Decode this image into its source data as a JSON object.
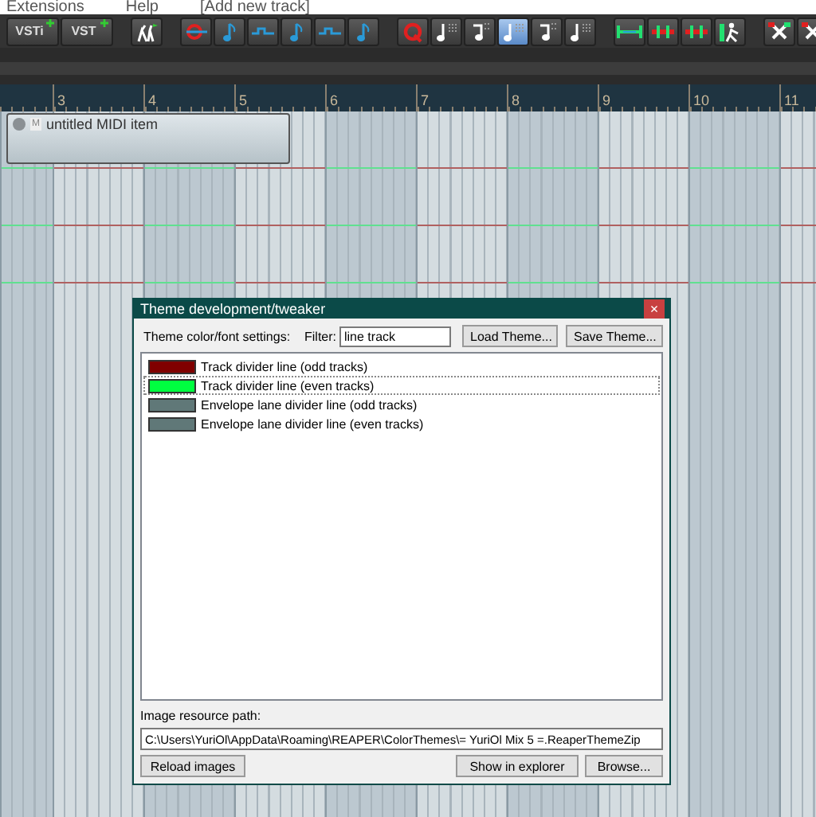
{
  "menu_bar": {
    "items": [
      "Extensions",
      "Help",
      "[Add new track]"
    ]
  },
  "toolbar": {
    "groups": [
      [
        {
          "kind": "vsti",
          "label": "VSTi",
          "selected": false
        },
        {
          "kind": "vst",
          "label": "VST",
          "selected": false
        }
      ],
      [
        {
          "kind": "walk",
          "selected": false
        }
      ],
      [
        {
          "kind": "quantize",
          "selected": false
        },
        {
          "kind": "note",
          "selected": false
        },
        {
          "kind": "tie",
          "selected": false
        },
        {
          "kind": "note",
          "selected": false
        },
        {
          "kind": "tie",
          "selected": false
        },
        {
          "kind": "note",
          "selected": false
        }
      ],
      [
        {
          "kind": "quantizeq",
          "selected": false
        },
        {
          "kind": "grid",
          "selected": false
        },
        {
          "kind": "tuplet",
          "selected": false
        },
        {
          "kind": "grid",
          "selected": true
        },
        {
          "kind": "tuplet",
          "selected": false
        },
        {
          "kind": "grid",
          "selected": false
        }
      ],
      [
        {
          "kind": "span",
          "selected": false
        },
        {
          "kind": "split",
          "selected": false
        },
        {
          "kind": "split",
          "selected": false
        },
        {
          "kind": "figure",
          "selected": false
        }
      ],
      [
        {
          "kind": "cut",
          "selected": false
        },
        {
          "kind": "cut",
          "selected": false
        }
      ]
    ]
  },
  "ruler": {
    "measures": [
      "3",
      "4",
      "5",
      "6",
      "7",
      "8",
      "9",
      "10",
      "11"
    ]
  },
  "midi_item": {
    "title": "untitled MIDI item",
    "mute_label": "M"
  },
  "dialog": {
    "title": "Theme development/tweaker",
    "close": "×",
    "settings_label": "Theme color/font settings:",
    "filter_label": "Filter:",
    "filter_value": "line track",
    "load_button": "Load Theme...",
    "save_button": "Save Theme...",
    "items": [
      {
        "label": "Track divider line (odd tracks)",
        "color": "#800000",
        "selected": false
      },
      {
        "label": "Track divider line (even tracks)",
        "color": "#00ff40",
        "selected": true
      },
      {
        "label": "Envelope lane divider line (odd tracks)",
        "color": "#607878",
        "selected": false
      },
      {
        "label": "Envelope lane divider line (even tracks)",
        "color": "#607878",
        "selected": false
      }
    ],
    "path_label": "Image resource path:",
    "path_value": "C:\\Users\\YuriOl\\AppData\\Roaming\\REAPER\\ColorThemes\\= YuriOl Mix 5 =.ReaperThemeZip",
    "reload_button": "Reload images",
    "explorer_button": "Show in explorer",
    "browse_button": "Browse..."
  }
}
